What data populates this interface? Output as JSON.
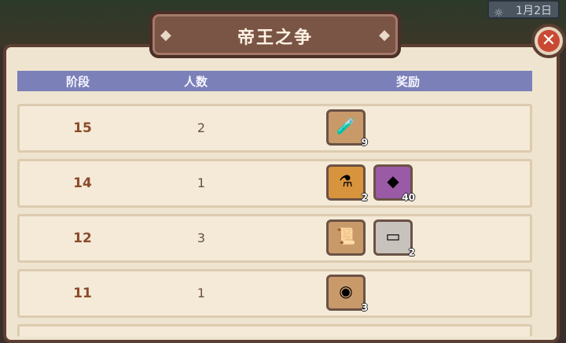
{
  "background": {
    "date_text": "1月2日"
  },
  "dialog": {
    "title": "帝王之争"
  },
  "table": {
    "headers": {
      "stage": "阶段",
      "count": "人数",
      "reward": "奖励"
    },
    "rows": [
      {
        "stage": "15",
        "count": "2",
        "rewards": [
          {
            "icon": "bottle-icon",
            "qty": "9",
            "color": "tan"
          }
        ]
      },
      {
        "stage": "14",
        "count": "1",
        "rewards": [
          {
            "icon": "potion-icon",
            "qty": "2",
            "color": "orange"
          },
          {
            "icon": "ore-icon",
            "qty": "40",
            "color": "purple"
          }
        ]
      },
      {
        "stage": "12",
        "count": "3",
        "rewards": [
          {
            "icon": "scroll-swap-icon",
            "qty": "",
            "color": "tan"
          },
          {
            "icon": "ticket-icon",
            "qty": "2",
            "color": "gray"
          }
        ]
      },
      {
        "stage": "11",
        "count": "1",
        "rewards": [
          {
            "icon": "orb-icon",
            "qty": "3",
            "color": "tan"
          }
        ]
      }
    ]
  }
}
